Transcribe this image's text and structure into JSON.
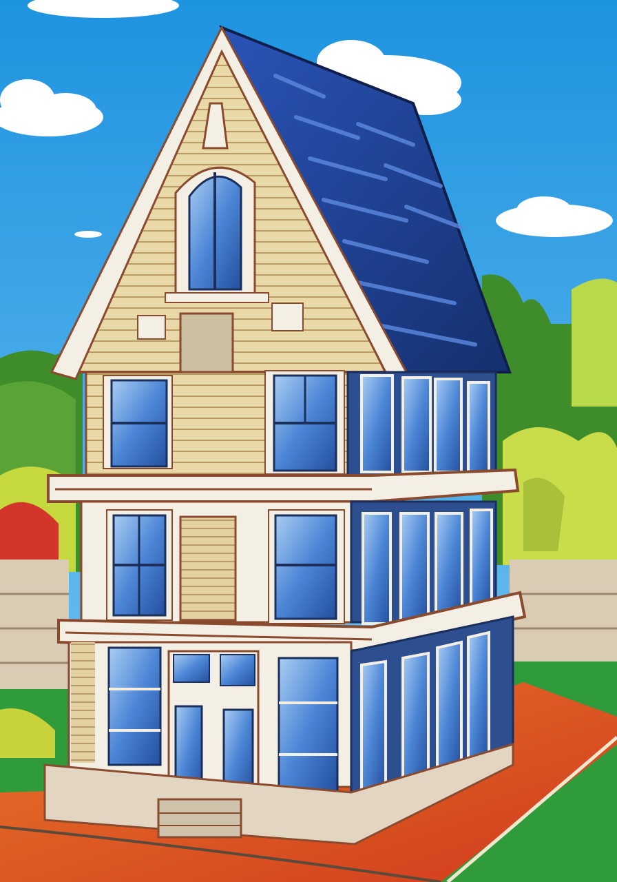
{
  "image": {
    "subject": "three-story-house-with-gabled-roof",
    "style": "cartoon-illustration"
  },
  "colors": {
    "sky_top": "#1e93e0",
    "sky_bottom": "#7cc8f2",
    "cloud": "#ffffff",
    "roof_blue": "#1d3f8f",
    "roof_highlight": "#3f6fd0",
    "siding": "#e9d9a8",
    "siding_line": "#b89a66",
    "trim_white": "#f4efe4",
    "trim_brown": "#8a4a2e",
    "window_glass": "#3a6fc4",
    "window_glass_light": "#9ec3f0",
    "wall_blue": "#2e4f8f",
    "tree_green": "#3e9a2a",
    "tree_light": "#b9d94a",
    "fence": "#d9cbb4",
    "path_orange": "#e25a24",
    "path_red": "#c9321c",
    "grass": "#2f9b3a"
  }
}
